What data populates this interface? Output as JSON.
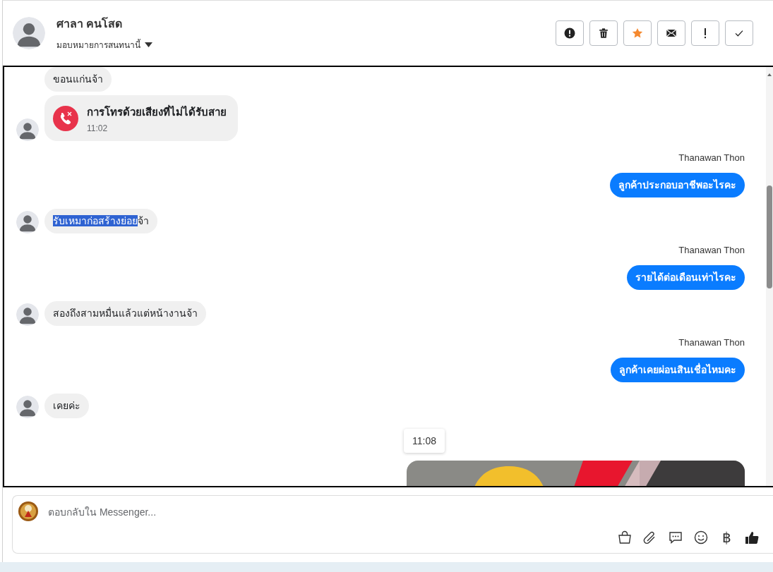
{
  "header": {
    "contact_name": "ศาลา คนโสด",
    "assign_label": "มอบหมายการสนทนานี้",
    "actions": [
      {
        "kind": "report",
        "on": false
      },
      {
        "kind": "delete",
        "on": false
      },
      {
        "kind": "star",
        "on": true
      },
      {
        "kind": "mail",
        "on": false
      },
      {
        "kind": "important",
        "on": false
      },
      {
        "kind": "done",
        "on": false
      }
    ]
  },
  "messages": [
    {
      "kind": "text",
      "outgoing": false,
      "parts": [
        {
          "text": "ขอนแก่นจ้า",
          "selected": false
        }
      ]
    },
    {
      "kind": "missed_call",
      "outgoing": false,
      "title": "การโทรด้วยเสียงที่ไม่ได้รับสาย",
      "time": "11:02"
    },
    {
      "kind": "text",
      "outgoing": true,
      "sender": "Thanawan Thon",
      "parts": [
        {
          "text": "ลูกค้าประกอบอาชีพอะไรคะ",
          "selected": false
        }
      ]
    },
    {
      "kind": "text",
      "outgoing": false,
      "parts": [
        {
          "text": "รับเหมาก่อสร้างย่อย",
          "selected": true
        },
        {
          "text": "จ้า",
          "selected": false
        }
      ]
    },
    {
      "kind": "text",
      "outgoing": true,
      "sender": "Thanawan Thon",
      "parts": [
        {
          "text": "รายได้ต่อเดือนเท่าไรคะ",
          "selected": false
        }
      ]
    },
    {
      "kind": "text",
      "outgoing": false,
      "parts": [
        {
          "text": "สองถึงสามหมื่นแล้วแต่หน้างานจ้า",
          "selected": false
        }
      ]
    },
    {
      "kind": "text",
      "outgoing": true,
      "sender": "Thanawan Thon",
      "parts": [
        {
          "text": "ลูกค้าเคยผ่อนสินเชื่อไหมคะ",
          "selected": false
        }
      ]
    },
    {
      "kind": "text",
      "outgoing": false,
      "parts": [
        {
          "text": "เคยค่ะ",
          "selected": false
        }
      ]
    },
    {
      "kind": "image",
      "outgoing": true,
      "time_tooltip": "11:08"
    }
  ],
  "composer": {
    "placeholder": "ตอบกลับใน Messenger...",
    "tools": [
      {
        "kind": "bag"
      },
      {
        "kind": "clip"
      },
      {
        "kind": "chat"
      },
      {
        "kind": "emoji"
      },
      {
        "kind": "currency",
        "symbol": "฿"
      },
      {
        "kind": "like"
      }
    ]
  }
}
